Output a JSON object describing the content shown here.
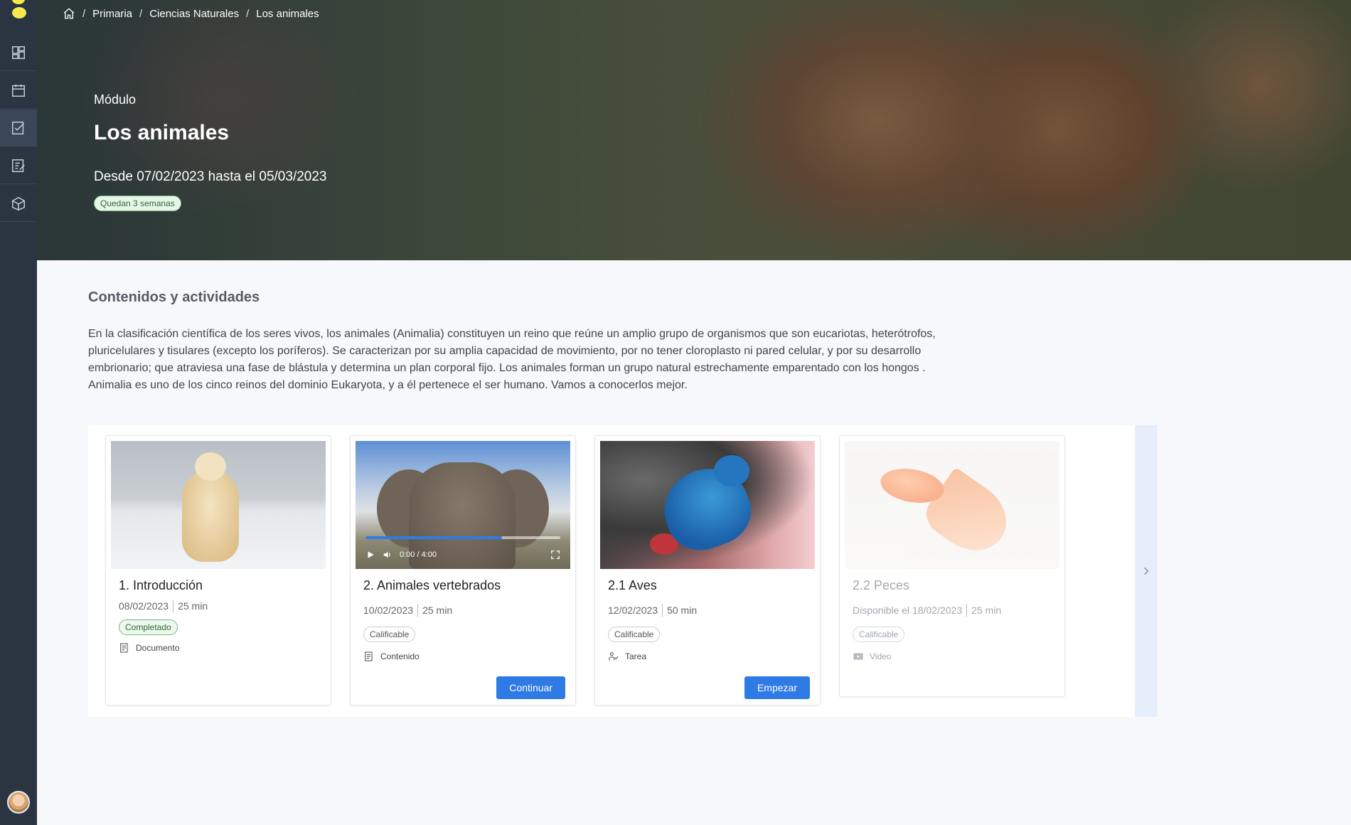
{
  "sidebar": {
    "items": [
      {
        "icon": "dashboard-icon"
      },
      {
        "icon": "calendar-icon"
      },
      {
        "icon": "tasks-icon"
      },
      {
        "icon": "grades-icon"
      },
      {
        "icon": "box-icon"
      }
    ]
  },
  "breadcrumb": {
    "items": [
      "Primaria",
      "Ciencias Naturales",
      "Los animales"
    ]
  },
  "hero": {
    "label": "Módulo",
    "title": "Los animales",
    "dates": "Desde 07/02/2023 hasta el 05/03/2023",
    "badge": "Quedan 3 semanas"
  },
  "section": {
    "title": "Contenidos y actividades",
    "description": "En la clasificación científica de los seres vivos, los animales (Animalia) constituyen un reino que reúne un amplio grupo de organismos que son eucariotas, heterótrofos, pluricelulares y tisulares (excepto los poríferos). Se caracterizan por su amplia capacidad de movimiento, por no tener cloroplasto ni pared celular, y por su desarrollo embrionario; que atraviesa una fase de blástula y determina un plan corporal fijo. Los animales forman un grupo natural estrechamente emparentado con los hongos . Animalia es uno de los cinco reinos del dominio Eukaryota, y a él pertenece el ser humano. Vamos a conocerlos mejor."
  },
  "cards": [
    {
      "title": "1. Introducción",
      "date": "08/02/2023",
      "duration": "25 min",
      "tag": "Completado",
      "type": "Documento"
    },
    {
      "title": "2. Animales vertebrados",
      "date": "10/02/2023",
      "duration": "25 min",
      "tag": "Calificable",
      "type": "Contenido",
      "button": "Continuar",
      "video_time": "0:00 / 4:00",
      "video_progress": 0.7
    },
    {
      "title": "2.1 Aves",
      "date": "12/02/2023",
      "duration": "50 min",
      "tag": "Calificable",
      "type": "Tarea",
      "button": "Empezar"
    },
    {
      "title": "2.2 Peces",
      "date": "Disponible el 18/02/2023",
      "duration": "25 min",
      "tag": "Calificable",
      "type": "Video"
    }
  ],
  "colors": {
    "sidebar": "#2b3441",
    "accent": "#2f7be5",
    "badge_green": "#79c185"
  }
}
